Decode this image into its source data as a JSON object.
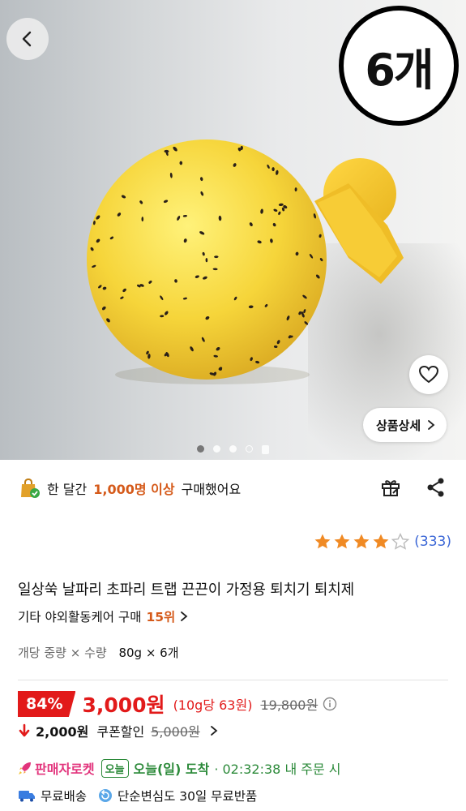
{
  "hero": {
    "count_badge": "6개",
    "detail_button": "상품상세",
    "carousel_total": 5,
    "carousel_active": 1
  },
  "social_proof": {
    "prefix": "한 달간",
    "count": "1,000명 이상",
    "suffix": "구매했어요"
  },
  "rating": {
    "stars": 4,
    "max": 5,
    "count": "(333)"
  },
  "product": {
    "title": "일상쑥 날파리 초파리 트랩 끈끈이 가정용 퇴치기 퇴치제",
    "category": "기타 야외활동케어 구매",
    "rank": "15위"
  },
  "option": {
    "label": "개당 중량 × 수량",
    "value": "80g × 6개"
  },
  "price": {
    "discount": "84%",
    "sale": "3,000원",
    "unit_price": "(10g당 63원)",
    "original": "19,800원"
  },
  "coupon": {
    "amount": "2,000원",
    "label": "쿠폰할인",
    "price": "5,000원"
  },
  "delivery": {
    "program": "판매자로켓",
    "badge": "오늘",
    "arrival": "오늘(일) 도착",
    "deadline": "· 02:32:38 내 주문 시"
  },
  "shipping": {
    "free_ship": "무료배송",
    "return": "단순변심도 30일 무료반품"
  },
  "colors": {
    "accent_red": "#e21a1a",
    "accent_orange": "#d55a1a",
    "rocket_pink": "#e2347c",
    "delivery_green": "#2c8a3a",
    "link_blue": "#3a66d6"
  }
}
